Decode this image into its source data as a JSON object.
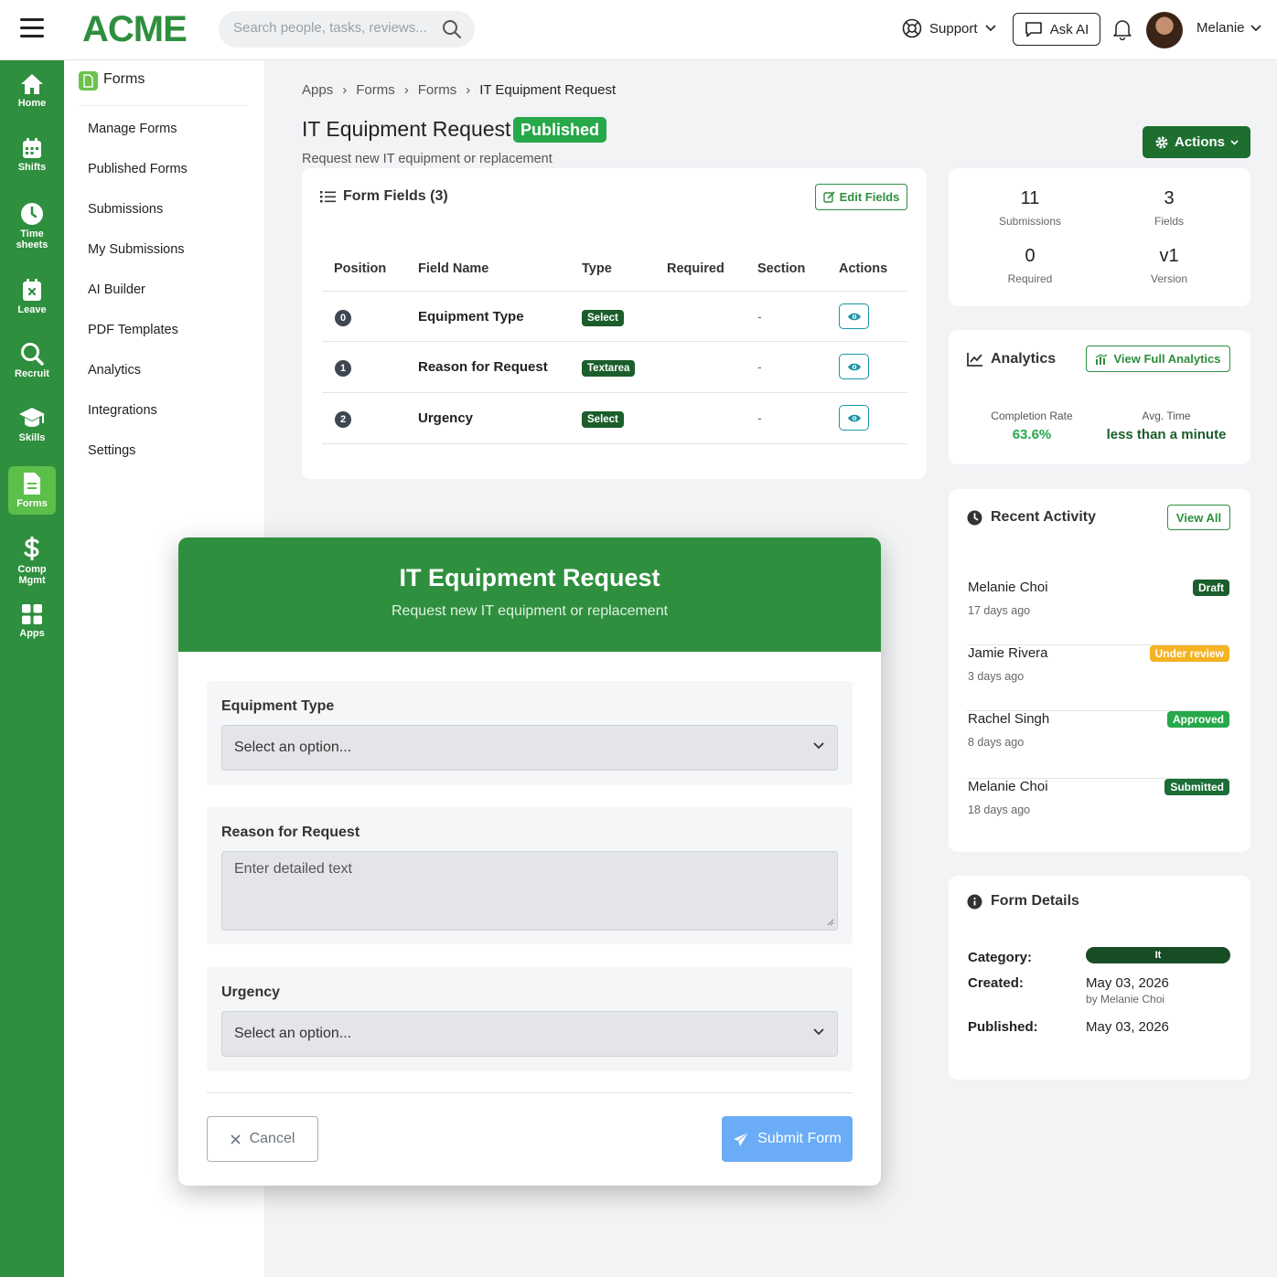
{
  "header": {
    "logo": "ACME",
    "search_placeholder": "Search people, tasks, reviews...",
    "support_label": "Support",
    "ask_ai_label": "Ask AI",
    "user_name": "Melanie"
  },
  "leftnav": [
    {
      "label": "Home",
      "icon": "home-icon"
    },
    {
      "label": "Shifts",
      "icon": "calendar-icon"
    },
    {
      "label": "Time sheets",
      "icon": "clock-icon"
    },
    {
      "label": "Leave",
      "icon": "leave-icon"
    },
    {
      "label": "Recruit",
      "icon": "search-icon"
    },
    {
      "label": "Skills",
      "icon": "graduation-cap-icon"
    },
    {
      "label": "Forms",
      "icon": "document-icon",
      "active": true
    },
    {
      "label": "Comp Mgmt",
      "icon": "dollar-icon"
    },
    {
      "label": "Apps",
      "icon": "grid-icon"
    }
  ],
  "subnav": {
    "title": "Forms",
    "items": [
      "Manage Forms",
      "Published Forms",
      "Submissions",
      "My Submissions",
      "AI Builder",
      "PDF Templates",
      "Analytics",
      "Integrations",
      "Settings"
    ]
  },
  "breadcrumb": [
    "Apps",
    "Forms",
    "Forms",
    "IT Equipment Request"
  ],
  "page": {
    "title": "IT Equipment Request",
    "status": "Published",
    "description": "Request new IT equipment or replacement",
    "actions_label": "Actions"
  },
  "form_fields": {
    "title": "Form Fields (3)",
    "edit_label": "Edit Fields",
    "columns": [
      "Position",
      "Field Name",
      "Type",
      "Required",
      "Section",
      "Actions"
    ],
    "rows": [
      {
        "position": "0",
        "name": "Equipment Type",
        "type": "Select",
        "required": "",
        "section": "-"
      },
      {
        "position": "1",
        "name": "Reason for Request",
        "type": "Textarea",
        "required": "",
        "section": "-"
      },
      {
        "position": "2",
        "name": "Urgency",
        "type": "Select",
        "required": "",
        "section": "-"
      }
    ]
  },
  "stats": [
    {
      "value": "11",
      "label": "Submissions"
    },
    {
      "value": "3",
      "label": "Fields"
    },
    {
      "value": "0",
      "label": "Required"
    },
    {
      "value": "v1",
      "label": "Version"
    }
  ],
  "analytics": {
    "title": "Analytics",
    "button": "View Full Analytics",
    "completion_label": "Completion Rate",
    "completion_value": "63.6%",
    "avg_label": "Avg. Time",
    "avg_value": "less than a minute",
    "accent": "#27a84a"
  },
  "activity": {
    "title": "Recent Activity",
    "button": "View All",
    "items": [
      {
        "name": "Melanie Choi",
        "when": "17 days ago",
        "status": "Draft",
        "color": "#1b5e2b"
      },
      {
        "name": "Jamie Rivera",
        "when": "3 days ago",
        "status": "Under review",
        "color": "#f5b323"
      },
      {
        "name": "Rachel Singh",
        "when": "8 days ago",
        "status": "Approved",
        "color": "#27a84a"
      },
      {
        "name": "Melanie Choi",
        "when": "18 days ago",
        "status": "Submitted",
        "color": "#1b6e36"
      }
    ]
  },
  "details": {
    "title": "Form Details",
    "category_label": "Category:",
    "category_value": "It",
    "created_label": "Created:",
    "created_value": "May 03, 2026",
    "created_by": "by Melanie Choi",
    "published_label": "Published:",
    "published_value": "May 03, 2026"
  },
  "modal": {
    "title": "IT Equipment Request",
    "subtitle": "Request new IT equipment or replacement",
    "fields": [
      {
        "label": "Equipment Type",
        "placeholder": "Select an option..."
      },
      {
        "label": "Reason for Request",
        "placeholder": "Enter detailed text"
      },
      {
        "label": "Urgency",
        "placeholder": "Select an option..."
      }
    ],
    "cancel_label": "Cancel",
    "submit_label": "Submit Form"
  }
}
